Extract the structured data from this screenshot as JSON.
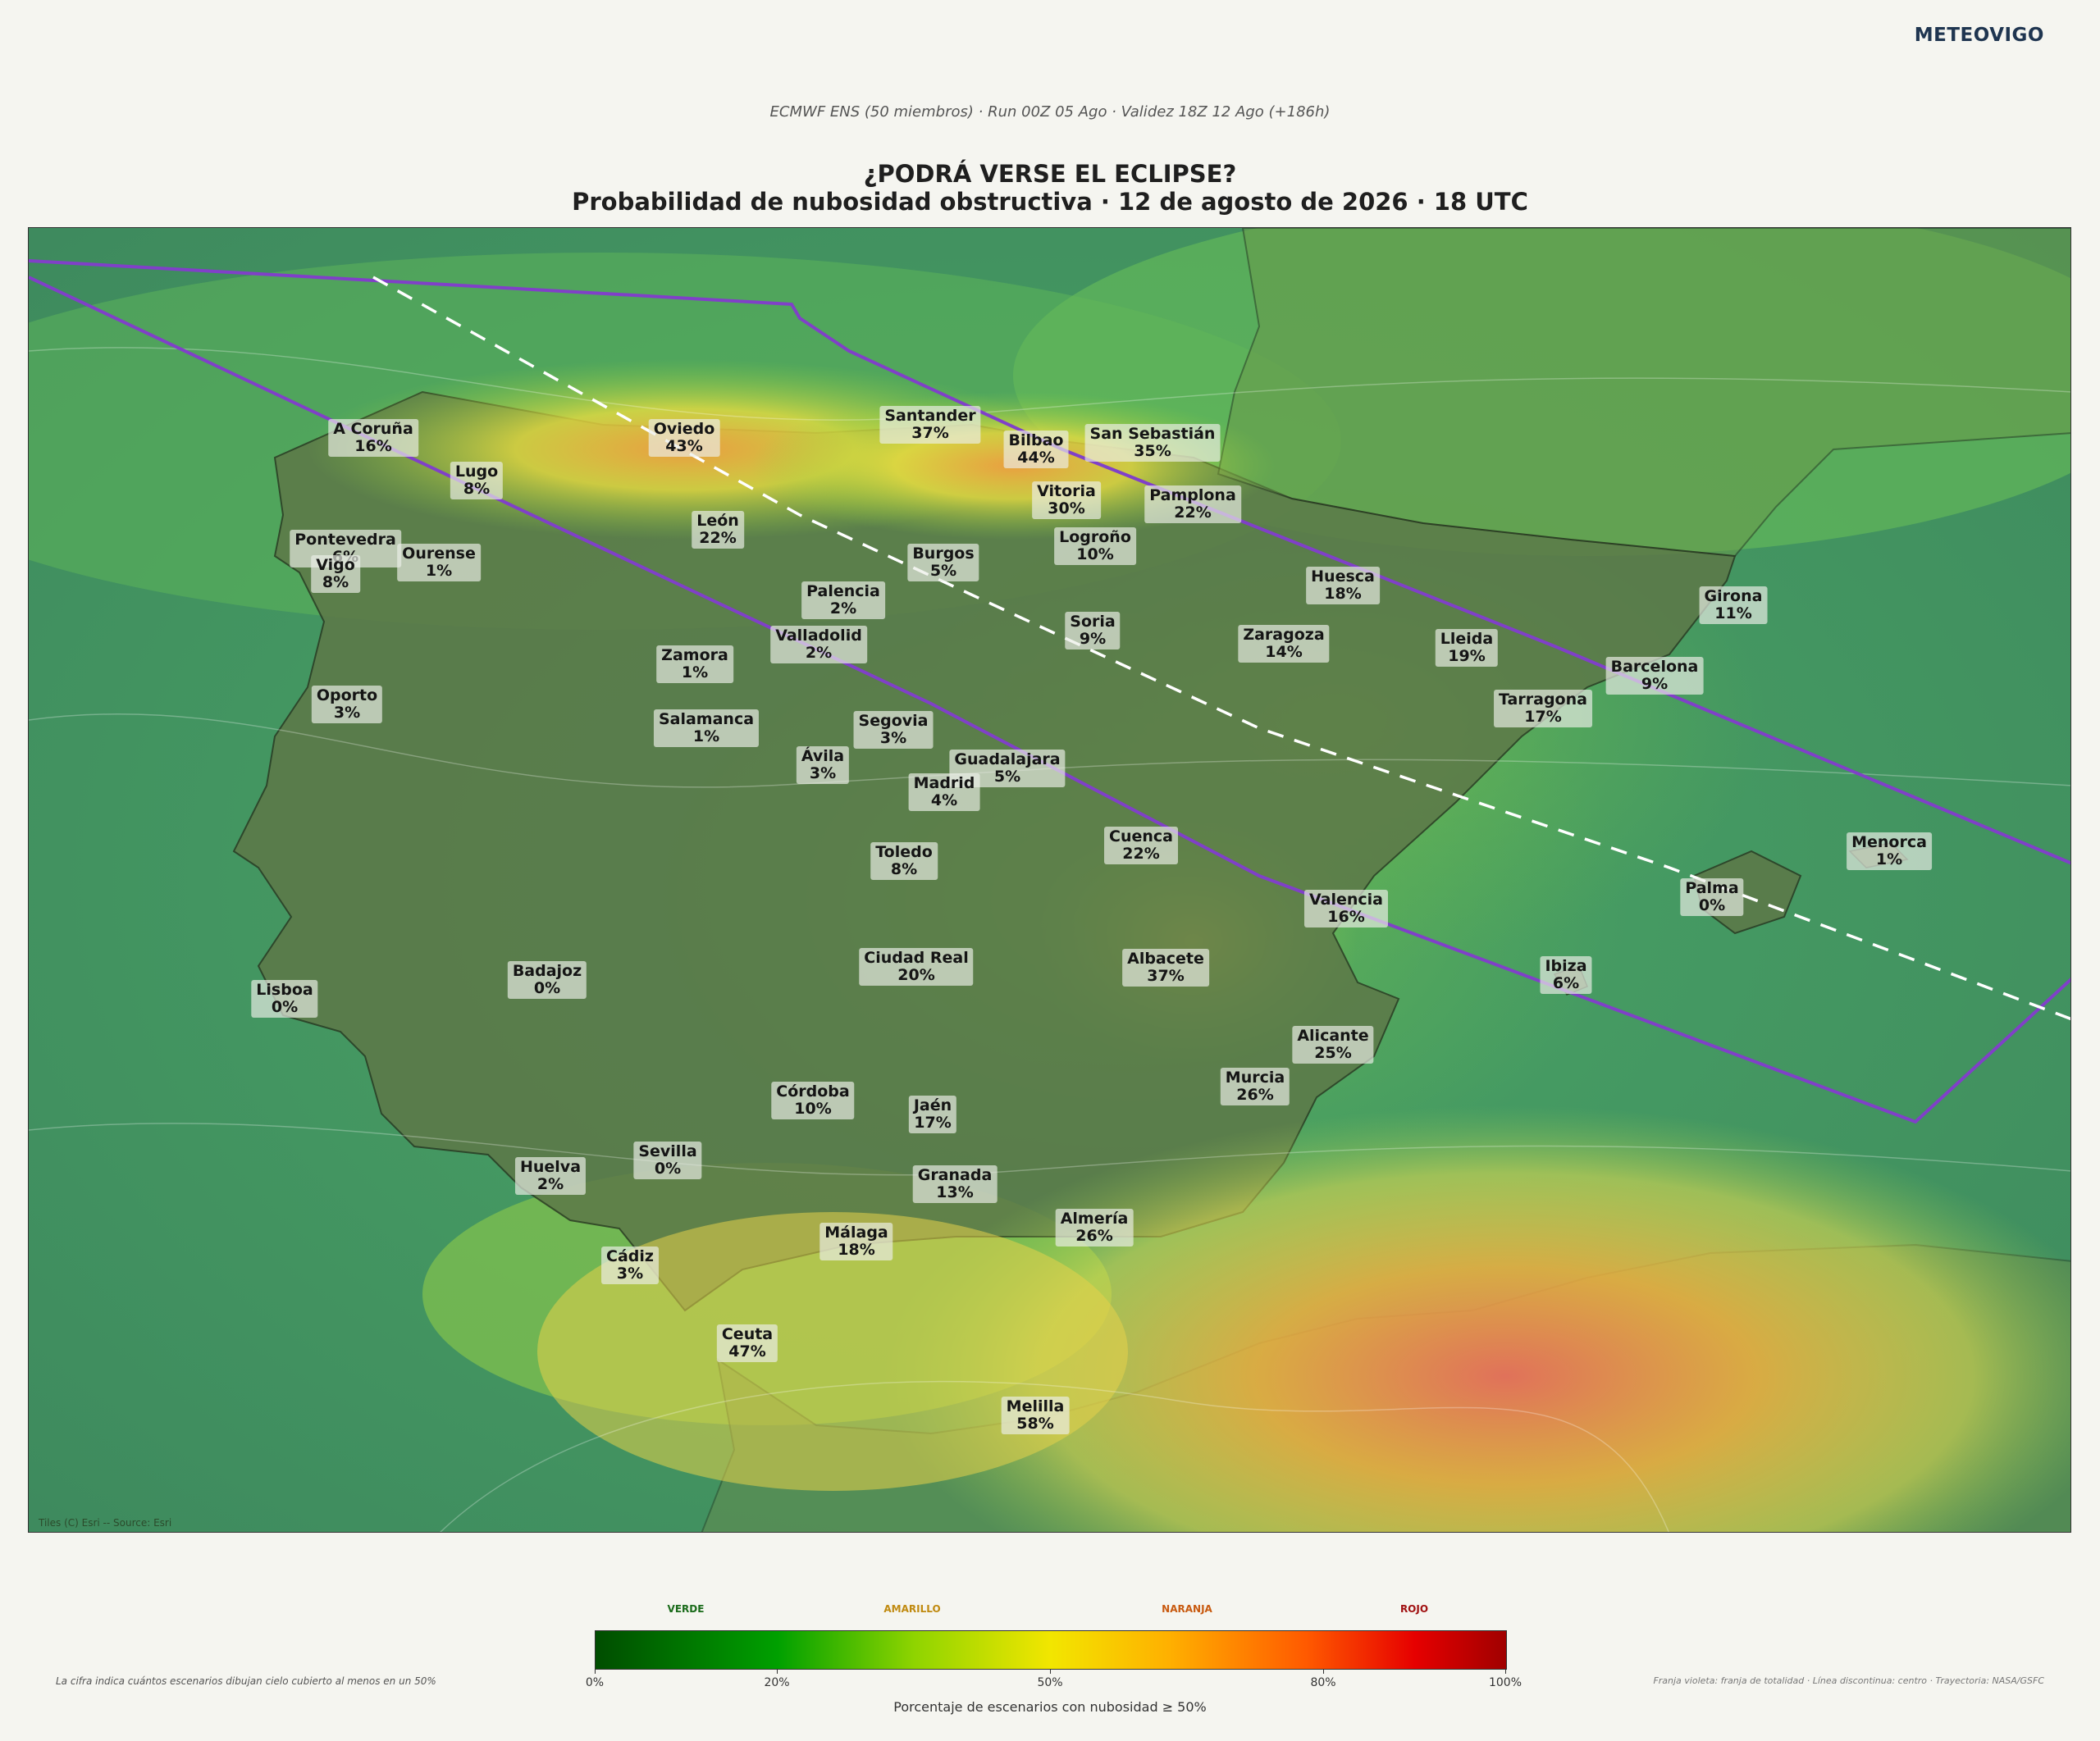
{
  "brand": "METEOVIGO",
  "subtitle": "ECMWF ENS (50 miembros) · Run 00Z 05 Ago · Validez 18Z 12 Ago (+186h)",
  "title_line1": "¿PODRÁ VERSE EL ECLIPSE?",
  "title_line2": "Probabilidad de nubosidad obstructiva · 12 de agosto de 2026 · 18 UTC",
  "tiles_credit": "Tiles (C) Esri -- Source: Esri",
  "colors": {
    "path": "#8040c8",
    "centerline": "#ffffff",
    "land": "#5e7a4a",
    "sea": "#3f8a5f"
  },
  "cities": [
    {
      "name": "A Coruña",
      "value": "16%"
    },
    {
      "name": "Lugo",
      "value": "8%"
    },
    {
      "name": "Pontevedra",
      "value": "6%"
    },
    {
      "name": "Vigo",
      "value": "8%"
    },
    {
      "name": "Ourense",
      "value": "1%"
    },
    {
      "name": "Oviedo",
      "value": "43%"
    },
    {
      "name": "Santander",
      "value": "37%"
    },
    {
      "name": "Bilbao",
      "value": "44%"
    },
    {
      "name": "San Sebastián",
      "value": "35%"
    },
    {
      "name": "Vitoria",
      "value": "30%"
    },
    {
      "name": "Pamplona",
      "value": "22%"
    },
    {
      "name": "León",
      "value": "22%"
    },
    {
      "name": "Burgos",
      "value": "5%"
    },
    {
      "name": "Logroño",
      "value": "10%"
    },
    {
      "name": "Huesca",
      "value": "18%"
    },
    {
      "name": "Girona",
      "value": "11%"
    },
    {
      "name": "Palencia",
      "value": "2%"
    },
    {
      "name": "Valladolid",
      "value": "2%"
    },
    {
      "name": "Soria",
      "value": "9%"
    },
    {
      "name": "Zaragoza",
      "value": "14%"
    },
    {
      "name": "Lleida",
      "value": "19%"
    },
    {
      "name": "Barcelona",
      "value": "9%"
    },
    {
      "name": "Tarragona",
      "value": "17%"
    },
    {
      "name": "Zamora",
      "value": "1%"
    },
    {
      "name": "Oporto",
      "value": "3%"
    },
    {
      "name": "Salamanca",
      "value": "1%"
    },
    {
      "name": "Segovia",
      "value": "3%"
    },
    {
      "name": "Ávila",
      "value": "3%"
    },
    {
      "name": "Guadalajara",
      "value": "5%"
    },
    {
      "name": "Madrid",
      "value": "4%"
    },
    {
      "name": "Cuenca",
      "value": "22%"
    },
    {
      "name": "Toledo",
      "value": "8%"
    },
    {
      "name": "Menorca",
      "value": "1%"
    },
    {
      "name": "Palma",
      "value": "0%"
    },
    {
      "name": "Valencia",
      "value": "16%"
    },
    {
      "name": "Ciudad Real",
      "value": "20%"
    },
    {
      "name": "Albacete",
      "value": "37%"
    },
    {
      "name": "Ibiza",
      "value": "6%"
    },
    {
      "name": "Badajoz",
      "value": "0%"
    },
    {
      "name": "Lisboa",
      "value": "0%"
    },
    {
      "name": "Alicante",
      "value": "25%"
    },
    {
      "name": "Murcia",
      "value": "26%"
    },
    {
      "name": "Córdoba",
      "value": "10%"
    },
    {
      "name": "Jaén",
      "value": "17%"
    },
    {
      "name": "Sevilla",
      "value": "0%"
    },
    {
      "name": "Huelva",
      "value": "2%"
    },
    {
      "name": "Granada",
      "value": "13%"
    },
    {
      "name": "Málaga",
      "value": "18%"
    },
    {
      "name": "Almería",
      "value": "26%"
    },
    {
      "name": "Cádiz",
      "value": "3%"
    },
    {
      "name": "Ceuta",
      "value": "47%"
    },
    {
      "name": "Melilla",
      "value": "58%"
    }
  ],
  "colorbar": {
    "title": "Porcentaje de escenarios con nubosidad ≥ 50%",
    "ticks": [
      "0%",
      "20%",
      "50%",
      "80%",
      "100%"
    ],
    "categories": [
      {
        "label": "VERDE",
        "color": "#1a6b1a"
      },
      {
        "label": "AMARILLO",
        "color": "#c08a10"
      },
      {
        "label": "NARANJA",
        "color": "#c85a10"
      },
      {
        "label": "ROJO",
        "color": "#a01010"
      }
    ]
  },
  "footer_left": "La cifra indica cuántos escenarios dibujan cielo cubierto al menos en un 50%",
  "footer_right": "Franja violeta: franja de totalidad · Línea discontinua: centro · Trayectoria: NASA/GSFC"
}
